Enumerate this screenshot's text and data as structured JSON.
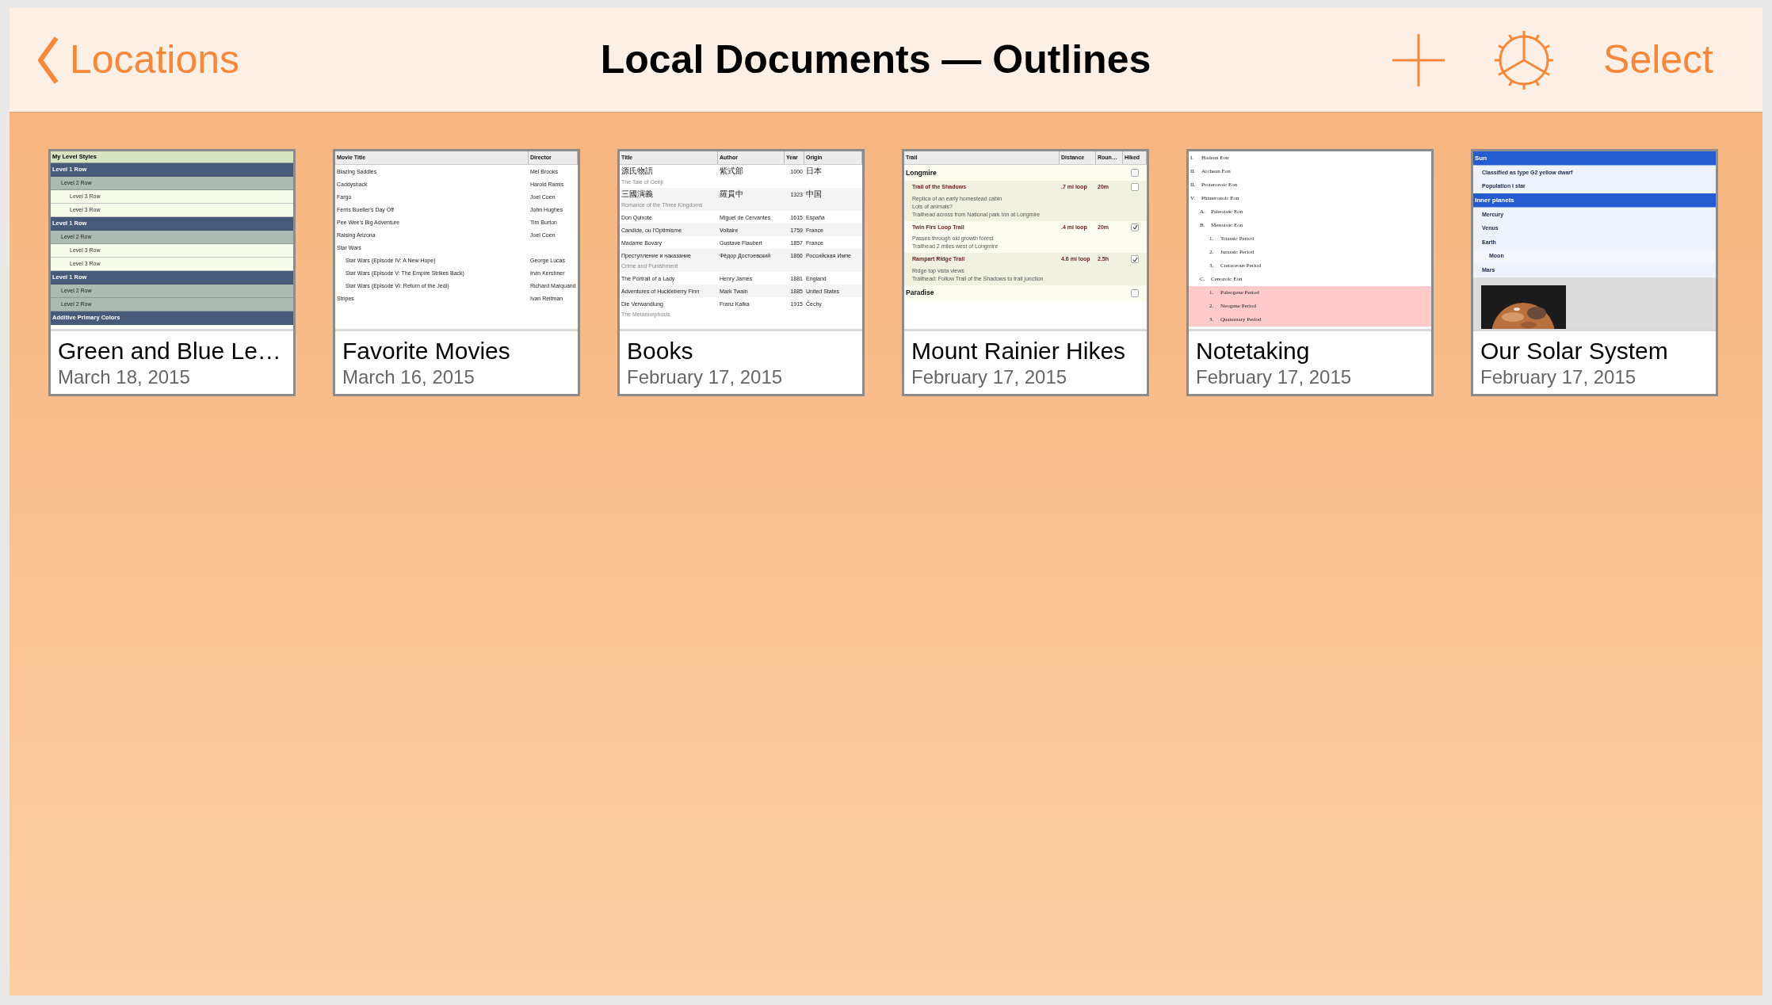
{
  "nav": {
    "back": "Locations",
    "title": "Local Documents — Outlines",
    "select": "Select"
  },
  "documents": [
    {
      "kind": "styles",
      "title": "Green and Blue Le…",
      "date": "March 18, 2015",
      "preview": {
        "heading": "My Level Styles",
        "rows": [
          {
            "text": "Level 1 Row",
            "children": [
              {
                "text": "Level 2 Row",
                "children": [
                  {
                    "text": "Level 3 Row"
                  },
                  {
                    "text": "Level 3 Row"
                  }
                ]
              }
            ]
          },
          {
            "text": "Level 1 Row",
            "children": [
              {
                "text": "Level 2 Row",
                "children": [
                  {
                    "text": "Level 3 Row"
                  },
                  {
                    "text": "Level 3 Row"
                  }
                ]
              }
            ]
          },
          {
            "text": "Level 1 Row",
            "children": [
              {
                "text": "Level 2 Row"
              },
              {
                "text": "Level 2 Row"
              }
            ]
          },
          {
            "text": "Additive Primary Colors"
          }
        ]
      }
    },
    {
      "kind": "movies",
      "title": "Favorite Movies",
      "date": "March 16, 2015",
      "preview": {
        "columns": [
          "Movie Title",
          "Director"
        ],
        "rows": [
          {
            "cells": [
              "Blazing Saddles",
              "Mel Brooks"
            ]
          },
          {
            "cells": [
              "Caddyshack",
              "Harold Ramis"
            ]
          },
          {
            "cells": [
              "Fargo",
              "Joel Coen"
            ]
          },
          {
            "cells": [
              "Ferris Bueller's Day Off",
              "John Hughes"
            ]
          },
          {
            "cells": [
              "Pee Wee's Big Adventure",
              "Tim Burton"
            ]
          },
          {
            "cells": [
              "Raising Arizona",
              "Joel Coen"
            ]
          },
          {
            "cells": [
              "Star Wars"
            ],
            "children": [
              {
                "cells": [
                  "Star Wars (Episode IV: A New Hope)",
                  "George Lucas"
                ]
              },
              {
                "cells": [
                  "Star Wars (Episode V: The Empire Strikes Back)",
                  "Irvin Kershner"
                ]
              },
              {
                "cells": [
                  "Star Wars (Episode VI: Return of the Jedi)",
                  "Richard Marquand"
                ]
              }
            ]
          },
          {
            "cells": [
              "Stripes",
              "Ivan Reitman"
            ]
          }
        ]
      }
    },
    {
      "kind": "books",
      "title": "Books",
      "date": "February 17, 2015",
      "preview": {
        "columns": [
          "Title",
          "Author",
          "Year",
          "Origin"
        ],
        "rows": [
          {
            "cells": [
              "源氏物語",
              "紫式部",
              "1000",
              "日本"
            ],
            "note": "The Tale of Genji"
          },
          {
            "cells": [
              "三國演義",
              "羅貫中",
              "1323",
              "中国"
            ],
            "note": "Romance of the Three Kingdoms"
          },
          {
            "cells": [
              "Don Quixote",
              "Miguel de Cervantes",
              "1615",
              "España"
            ]
          },
          {
            "cells": [
              "Candide, ou l'Optimisme",
              "Voltaire",
              "1759",
              "France"
            ]
          },
          {
            "cells": [
              "Madame Bovary",
              "Gustave Flaubert",
              "1857",
              "France"
            ]
          },
          {
            "cells": [
              "Преступление и наказание",
              "Фёдор Достоевский",
              "1866",
              "Российская Импе"
            ],
            "note": "Crime and Punishment"
          },
          {
            "cells": [
              "The Portrait of a Lady",
              "Henry James",
              "1881",
              "England"
            ]
          },
          {
            "cells": [
              "Adventures of Huckleberry Finn",
              "Mark Twain",
              "1885",
              "United States"
            ]
          },
          {
            "cells": [
              "Die Verwandlung",
              "Franz Kafka",
              "1915",
              "Čechy"
            ],
            "note": "The Metamorphosis"
          }
        ]
      }
    },
    {
      "kind": "hikes",
      "title": "Mount Rainier Hikes",
      "date": "February 17, 2015",
      "preview": {
        "columns": [
          "Trail",
          "Distance",
          "Roun…",
          "Hiked"
        ],
        "groups": [
          {
            "name": "Longmire",
            "checked": false,
            "children": [
              {
                "name": "Trail of the Shadows",
                "distance": ".7 mi loop",
                "time": "20m",
                "checked": false,
                "notes": [
                  "Replica of an early homestead cabin",
                  "Lots of animals?",
                  "Trailhead across from National park Inn at Longmire"
                ]
              },
              {
                "name": "Twin Firs Loop Trail",
                "distance": ".4 mi loop",
                "time": "20m",
                "checked": true,
                "notes": [
                  "Passes through old growth forest",
                  "Trailhead 2 miles west of Longmire"
                ]
              },
              {
                "name": "Rampart Ridge Trail",
                "distance": "4.6 mi loop",
                "time": "2.5h",
                "checked": true,
                "notes": [
                  "Ridge top vista views",
                  "Trailhead: Follow Trail of the Shadows to trail junction"
                ]
              }
            ]
          },
          {
            "name": "Paradise",
            "checked": false
          }
        ]
      }
    },
    {
      "kind": "notes",
      "title": "Notetaking",
      "date": "February 17, 2015",
      "preview": {
        "items": [
          {
            "marker": "I.",
            "text": "Hadean Eon",
            "highlighted": false
          },
          {
            "marker": "II.",
            "text": "Archean Eon",
            "highlighted": false
          },
          {
            "marker": "II.",
            "text": "Proterozoic Eon",
            "highlighted": false
          },
          {
            "marker": "V.",
            "text": "Phanerozoic Eon",
            "highlighted": false,
            "children": [
              {
                "marker": "A.",
                "text": "Paleozoic Eon",
                "highlighted": false
              },
              {
                "marker": "B.",
                "text": "Mesozoic Eon",
                "highlighted": false,
                "children": [
                  {
                    "marker": "1.",
                    "text": "Triassic Period",
                    "highlighted": false
                  },
                  {
                    "marker": "2.",
                    "text": "Jurassic Period",
                    "highlighted": false
                  },
                  {
                    "marker": "3.",
                    "text": "Cretaceous Period",
                    "highlighted": false
                  }
                ]
              },
              {
                "marker": "C.",
                "text": "Cenozoic Eon",
                "highlighted": false,
                "children": [
                  {
                    "marker": "1.",
                    "text": "Paleogene Period",
                    "highlighted": true
                  },
                  {
                    "marker": "2.",
                    "text": "Neogene Period",
                    "highlighted": true
                  },
                  {
                    "marker": "3.",
                    "text": "Quaternary Period",
                    "highlighted": true
                  }
                ]
              }
            ]
          }
        ]
      }
    },
    {
      "kind": "solar",
      "title": "Our Solar System",
      "date": "February 17, 2015",
      "preview": {
        "rows": [
          {
            "text": "Sun",
            "children": [
              {
                "text": "Classified as type G2 yellow dwarf"
              },
              {
                "text": "Population I star"
              }
            ]
          },
          {
            "text": "Inner planets",
            "children": [
              {
                "text": "Mercury"
              },
              {
                "text": "Venus"
              },
              {
                "text": "Earth",
                "children": [
                  {
                    "text": "Moon"
                  }
                ]
              },
              {
                "text": "Mars"
              }
            ]
          },
          {
            "kind": "picture"
          }
        ]
      }
    }
  ]
}
